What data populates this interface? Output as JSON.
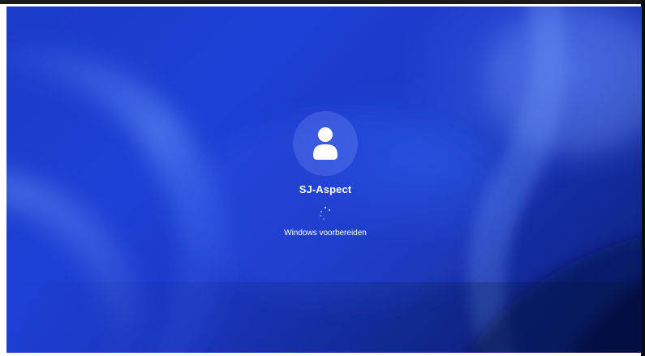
{
  "user": {
    "name": "SJ-Aspect",
    "avatar_icon": "user-icon"
  },
  "status": {
    "text": "Windows voorbereiden",
    "spinner_icon": "loading-spinner-icon"
  },
  "colors": {
    "background": "#1d40d6",
    "text": "#ffffff"
  }
}
